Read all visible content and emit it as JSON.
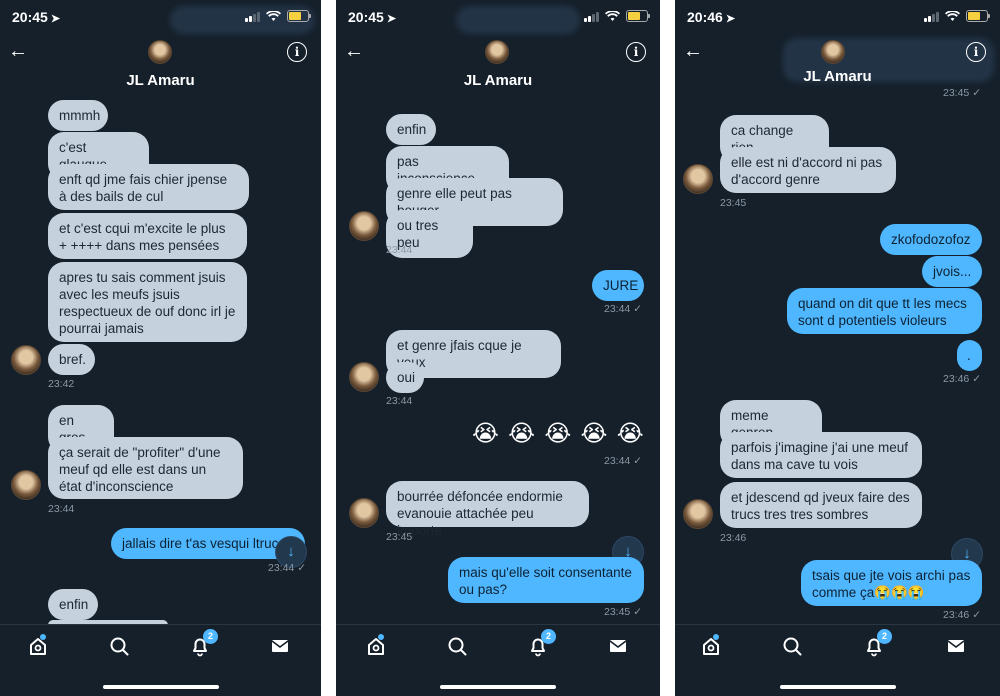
{
  "status": {
    "time1": "20:45",
    "time2": "20:45",
    "time3": "20:46"
  },
  "contact": {
    "name": "JL Amaru"
  },
  "tabs": {
    "notif_badge": "2"
  },
  "panel1": {
    "b1": "mmmh",
    "b2": "c'est glauque",
    "b3": "enft qd jme fais chier jpense à des bails de cul",
    "b4": "et c'est cqui m'excite le plus + ++++ dans mes pensées",
    "b5": "apres tu sais comment jsuis avec les meufs jsuis respectueux de ouf donc irl je pourrai jamais",
    "b6": "bref.",
    "t1": "23:42",
    "b7": "en gros",
    "b8": "ça serait de \"profiter\" d'une meuf qd elle est dans un état d'inconscience",
    "t2": "23:44",
    "b9": "jallais dire t'as vesqui ltruc",
    "t3": "23:44 ✓",
    "b10": "enfin"
  },
  "panel2": {
    "b1": "enfin",
    "b2": "pas inconscience",
    "b3": "genre elle peut pas bouger",
    "b4": "ou tres peu",
    "t1": "23:44",
    "b5": "JURE",
    "t2": "23:44 ✓",
    "b6": "et genre jfais cque je veux",
    "b7": "oui",
    "t3": "23:44",
    "b8": "😭 😭 😭 😭 😭",
    "t4": "23:44 ✓",
    "b9": "bourrée défoncée endormie evanouie attachée peu importe",
    "t5": "23:45",
    "b10": "mais qu'elle soit consentante ou pas?",
    "t6": "23:45 ✓"
  },
  "panel3": {
    "t0": "23:45 ✓",
    "b1": "ca change rien",
    "b2": "elle est ni d'accord ni pas d'accord genre",
    "t1": "23:45",
    "b3": "zkofodozofoz",
    "b4": "jvois...",
    "b5": "quand on dit que tt les mecs sont d potentiels violeurs",
    "b6": ".",
    "t2": "23:46 ✓",
    "b7": "meme genrep",
    "b8": "parfois j'imagine j'ai une meuf dans ma cave tu vois",
    "b9": "et jdescend qd jveux faire des trucs tres tres sombres",
    "t3": "23:46",
    "b10": "tsais que jte vois archi pas comme ça😭😭😭",
    "t4": "23:46 ✓"
  }
}
